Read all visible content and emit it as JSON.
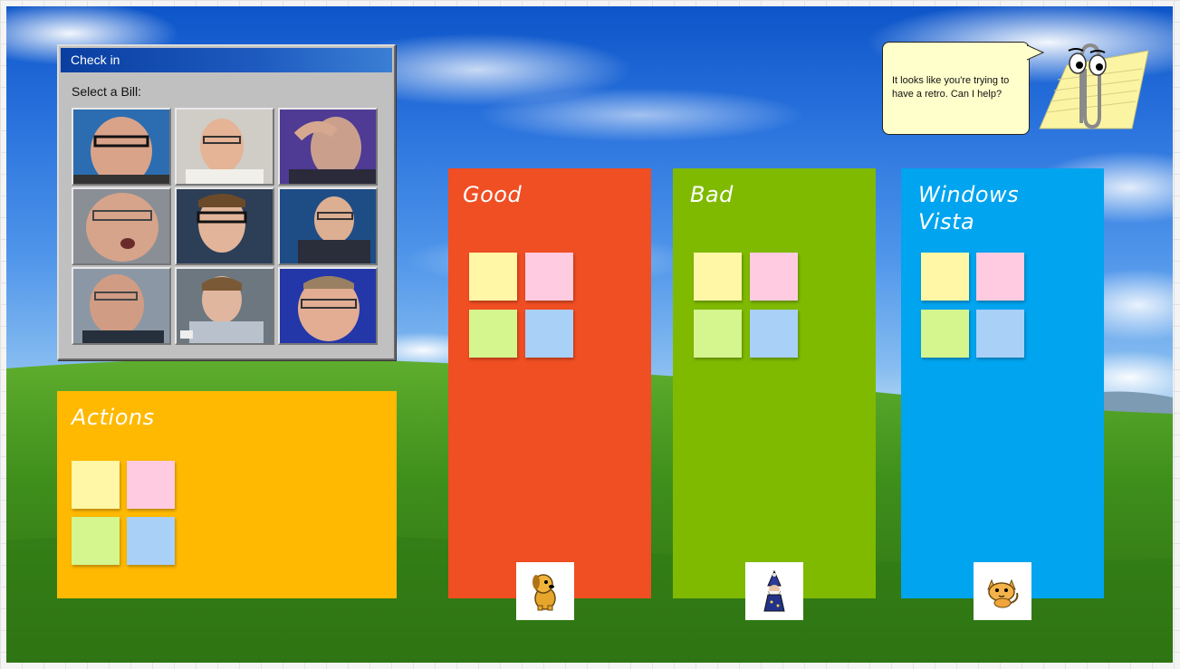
{
  "checkin": {
    "title": "Check in",
    "prompt": "Select a Bill:",
    "photos": [
      "bill-1",
      "bill-2",
      "bill-3",
      "bill-4",
      "bill-5",
      "bill-6",
      "bill-7",
      "bill-8",
      "bill-9"
    ]
  },
  "clippy": {
    "message": "It looks like you're trying to have a retro. Can I help?",
    "icon": "paperclip-assistant-icon"
  },
  "columns": {
    "good": {
      "title": "Good",
      "color": "#f04e23",
      "avatar": "dog-avatar-icon"
    },
    "bad": {
      "title": "Bad",
      "color": "#7fba00",
      "avatar": "wizard-avatar-icon"
    },
    "vista": {
      "title": "Windows Vista",
      "color": "#00a4ef",
      "avatar": "cat-avatar-icon"
    },
    "actions": {
      "title": "Actions",
      "color": "#ffb900"
    }
  },
  "sticky_colors": [
    "#fff7a6",
    "#ffcbe0",
    "#d5f58e",
    "#a9d0f7"
  ]
}
